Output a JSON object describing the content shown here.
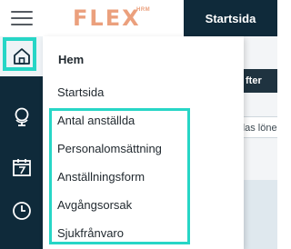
{
  "header": {
    "logo_text": "FLEX",
    "logo_sup": "HRM",
    "active_tab_label": "Startsida"
  },
  "sidebar": {
    "items": [
      {
        "icon": "home-icon",
        "active": true
      },
      {
        "icon": "globe-icon",
        "active": false
      },
      {
        "icon": "calendar-icon",
        "active": false
      },
      {
        "icon": "clock-icon",
        "active": false
      }
    ]
  },
  "background": {
    "button_partial": "fter",
    "field_partial": "das löne"
  },
  "menu": {
    "heading": "Hem",
    "items": [
      {
        "label": "Startsida"
      },
      {
        "label": "Antal anställda"
      },
      {
        "label": "Personalomsättning"
      },
      {
        "label": "Anställningsform"
      },
      {
        "label": "Avgångsorsak"
      },
      {
        "label": "Sjukfrånvaro"
      }
    ]
  },
  "colors": {
    "highlight": "#27d6c6",
    "sidebar": "#0f2a3a",
    "logo": "#eba07d"
  }
}
